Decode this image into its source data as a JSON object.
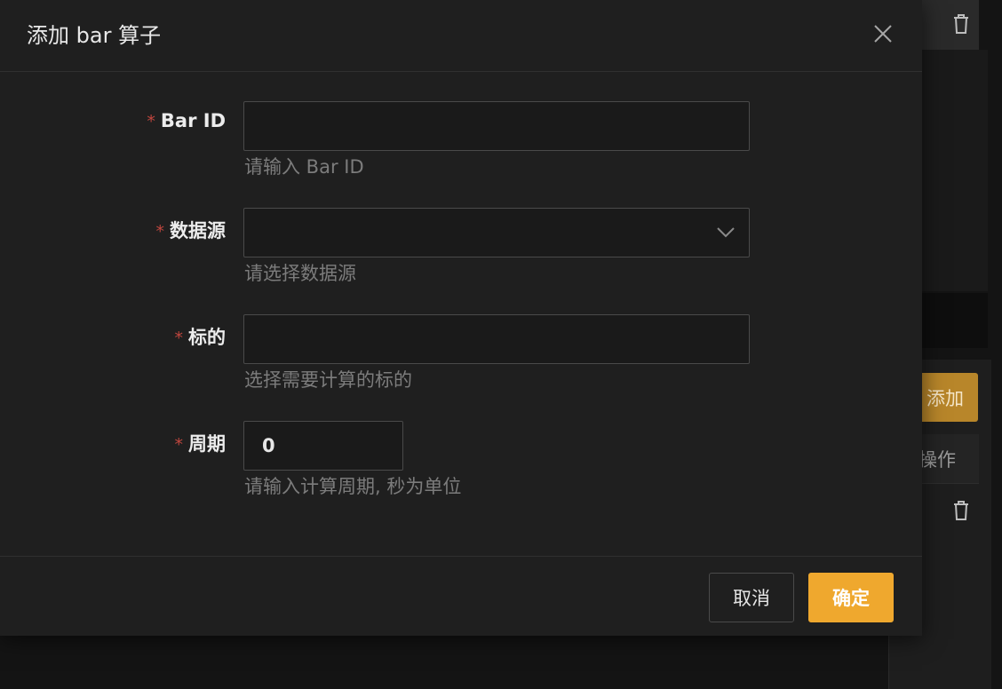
{
  "background": {
    "add_button_label": "添加",
    "ops_column_header": "操作"
  },
  "modal": {
    "title": "添加 bar 算子",
    "required_mark": "*",
    "fields": [
      {
        "label": "Bar ID",
        "value": "",
        "placeholder": "",
        "help": "请输入 Bar ID"
      },
      {
        "label": "数据源",
        "value": "",
        "placeholder": "",
        "help": "请选择数据源"
      },
      {
        "label": "标的",
        "value": "",
        "placeholder": "",
        "help": "选择需要计算的标的"
      },
      {
        "label": "周期",
        "value": "0",
        "placeholder": "",
        "help": "请输入计算周期, 秒为单位"
      }
    ],
    "footer": {
      "cancel_label": "取消",
      "ok_label": "确定"
    }
  },
  "colors": {
    "primary": "#efa82e",
    "required": "#c0463e",
    "modal_bg": "#1f1f1f"
  }
}
